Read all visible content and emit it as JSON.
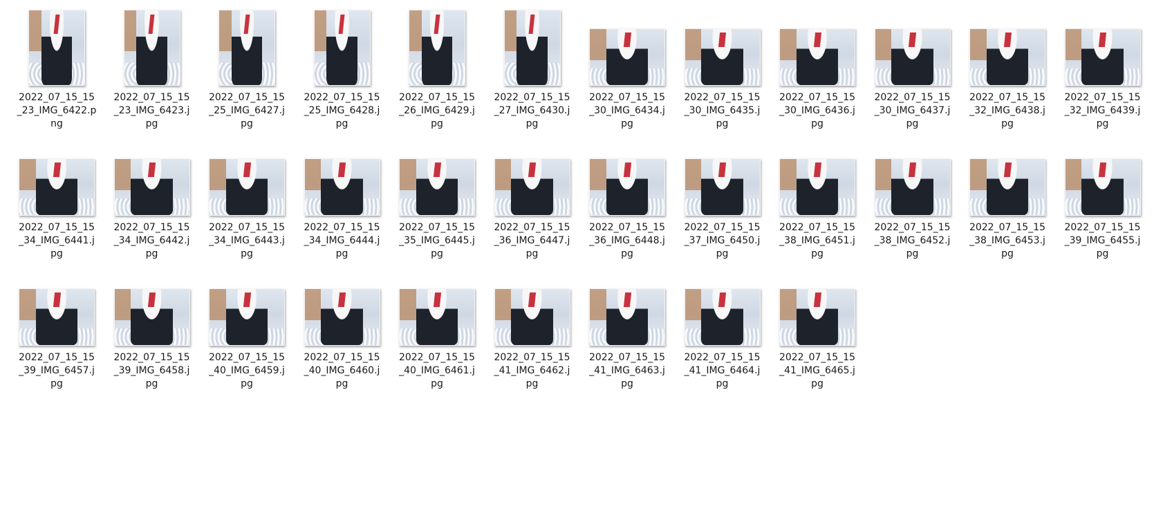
{
  "files": [
    {
      "name": "2022_07_15_15_23_IMG_6422.png",
      "orientation": "portrait"
    },
    {
      "name": "2022_07_15_15_23_IMG_6423.jpg",
      "orientation": "portrait"
    },
    {
      "name": "2022_07_15_15_25_IMG_6427.jpg",
      "orientation": "portrait"
    },
    {
      "name": "2022_07_15_15_25_IMG_6428.jpg",
      "orientation": "portrait"
    },
    {
      "name": "2022_07_15_15_26_IMG_6429.jpg",
      "orientation": "portrait"
    },
    {
      "name": "2022_07_15_15_27_IMG_6430.jpg",
      "orientation": "portrait"
    },
    {
      "name": "2022_07_15_15_30_IMG_6434.jpg",
      "orientation": "landscape"
    },
    {
      "name": "2022_07_15_15_30_IMG_6435.jpg",
      "orientation": "landscape"
    },
    {
      "name": "2022_07_15_15_30_IMG_6436.jpg",
      "orientation": "landscape"
    },
    {
      "name": "2022_07_15_15_30_IMG_6437.jpg",
      "orientation": "landscape"
    },
    {
      "name": "2022_07_15_15_32_IMG_6438.jpg",
      "orientation": "landscape"
    },
    {
      "name": "2022_07_15_15_32_IMG_6439.jpg",
      "orientation": "landscape"
    },
    {
      "name": "2022_07_15_15_34_IMG_6441.jpg",
      "orientation": "landscape"
    },
    {
      "name": "2022_07_15_15_34_IMG_6442.jpg",
      "orientation": "landscape"
    },
    {
      "name": "2022_07_15_15_34_IMG_6443.jpg",
      "orientation": "landscape"
    },
    {
      "name": "2022_07_15_15_34_IMG_6444.jpg",
      "orientation": "landscape"
    },
    {
      "name": "2022_07_15_15_35_IMG_6445.jpg",
      "orientation": "landscape"
    },
    {
      "name": "2022_07_15_15_36_IMG_6447.jpg",
      "orientation": "landscape"
    },
    {
      "name": "2022_07_15_15_36_IMG_6448.jpg",
      "orientation": "landscape"
    },
    {
      "name": "2022_07_15_15_37_IMG_6450.jpg",
      "orientation": "landscape"
    },
    {
      "name": "2022_07_15_15_38_IMG_6451.jpg",
      "orientation": "landscape"
    },
    {
      "name": "2022_07_15_15_38_IMG_6452.jpg",
      "orientation": "landscape"
    },
    {
      "name": "2022_07_15_15_38_IMG_6453.jpg",
      "orientation": "landscape"
    },
    {
      "name": "2022_07_15_15_39_IMG_6455.jpg",
      "orientation": "landscape"
    },
    {
      "name": "2022_07_15_15_39_IMG_6457.jpg",
      "orientation": "landscape"
    },
    {
      "name": "2022_07_15_15_39_IMG_6458.jpg",
      "orientation": "landscape"
    },
    {
      "name": "2022_07_15_15_40_IMG_6459.jpg",
      "orientation": "landscape"
    },
    {
      "name": "2022_07_15_15_40_IMG_6460.jpg",
      "orientation": "landscape"
    },
    {
      "name": "2022_07_15_15_40_IMG_6461.jpg",
      "orientation": "landscape"
    },
    {
      "name": "2022_07_15_15_41_IMG_6462.jpg",
      "orientation": "landscape"
    },
    {
      "name": "2022_07_15_15_41_IMG_6463.jpg",
      "orientation": "landscape"
    },
    {
      "name": "2022_07_15_15_41_IMG_6464.jpg",
      "orientation": "landscape"
    },
    {
      "name": "2022_07_15_15_41_IMG_6465.jpg",
      "orientation": "landscape"
    }
  ],
  "colors": {
    "background": "#ffffff",
    "label_text": "#1a1a1a",
    "tie_accent": "#c8323f"
  }
}
